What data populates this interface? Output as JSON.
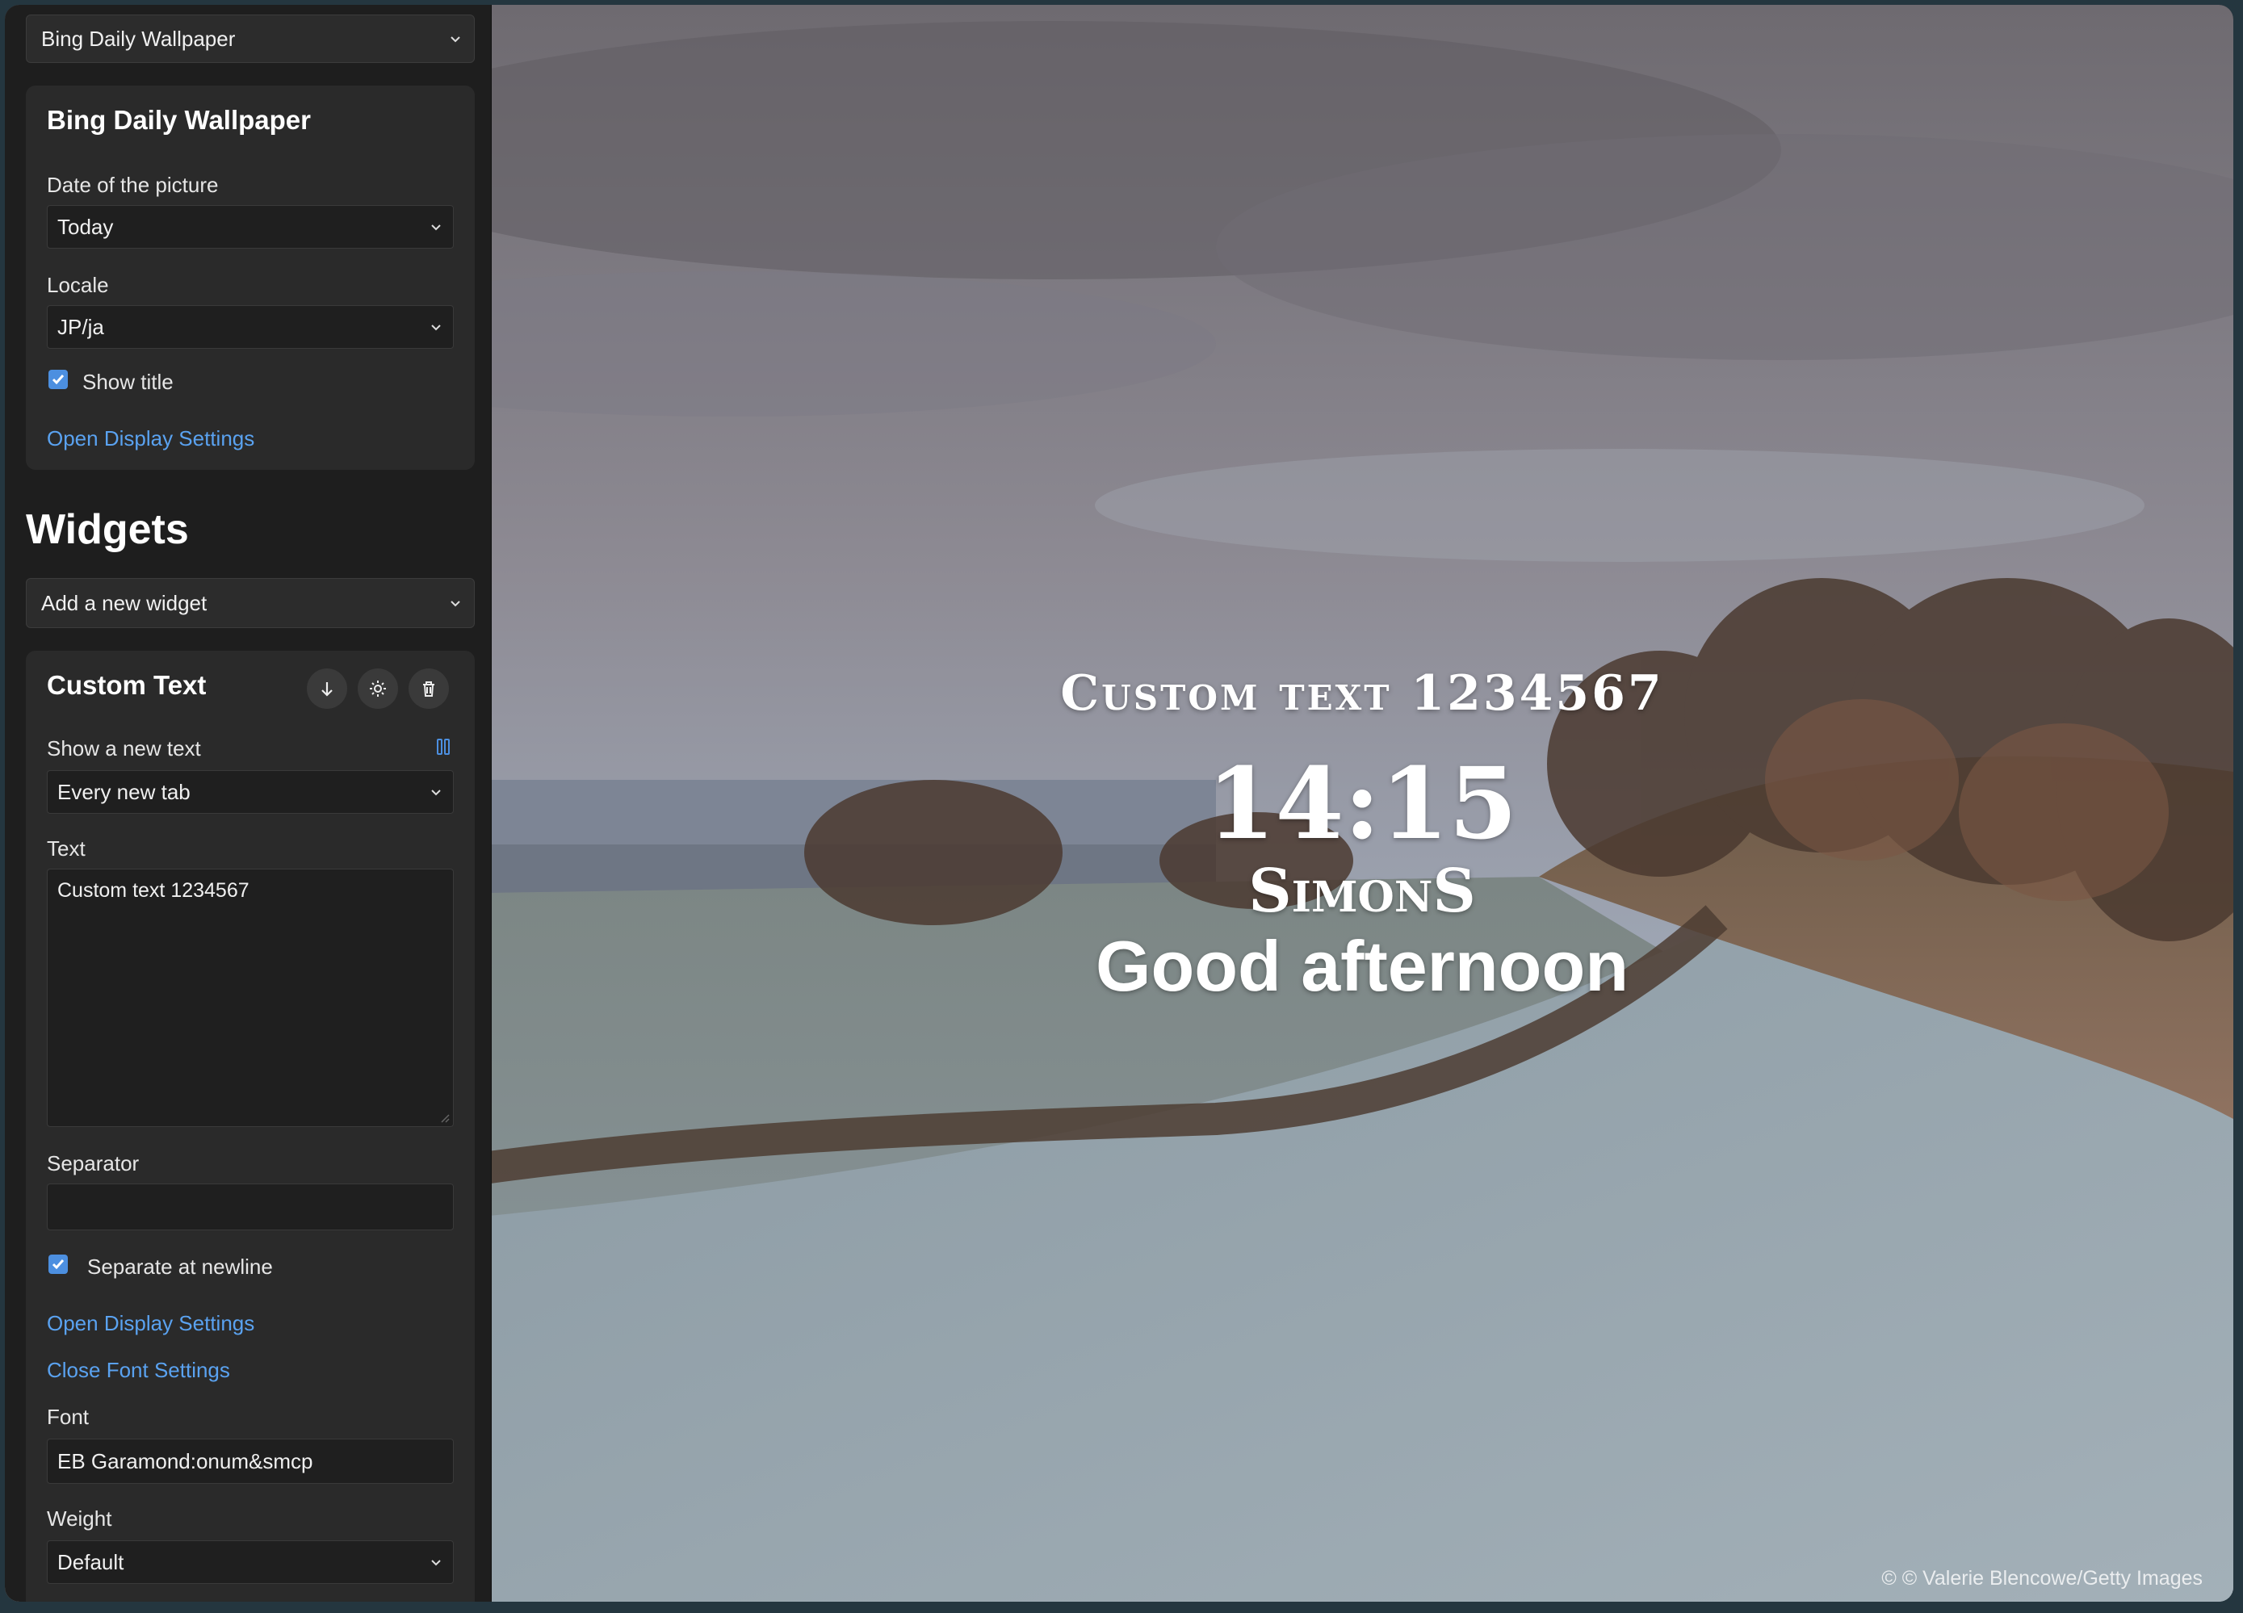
{
  "top_select": {
    "value": "Bing Daily Wallpaper"
  },
  "bing_card": {
    "title": "Bing Daily Wallpaper",
    "date_label": "Date of the picture",
    "date_value": "Today",
    "locale_label": "Locale",
    "locale_value": "JP/ja",
    "show_title_label": "Show title",
    "show_title_checked": true,
    "display_settings_link": "Open Display Settings"
  },
  "widgets": {
    "heading": "Widgets",
    "add_widget_select": "Add a new widget"
  },
  "custom_text_card": {
    "title": "Custom Text",
    "buttons": [
      {
        "icon": "arrow-down-icon",
        "name": "move-down-button"
      },
      {
        "icon": "gear-icon",
        "name": "settings-button"
      },
      {
        "icon": "trash-icon",
        "name": "delete-button"
      }
    ],
    "show_new_label": "Show a new text",
    "show_new_value": "Every new tab",
    "text_label": "Text",
    "text_value": "Custom text 1234567",
    "separator_label": "Separator",
    "separator_value": "",
    "separate_newline_label": "Separate at newline",
    "separate_newline_checked": true,
    "display_settings_link": "Open Display Settings",
    "font_settings_link": "Close Font Settings",
    "font_label": "Font",
    "font_value": "EB Garamond:onum&smcp",
    "weight_label": "Weight",
    "weight_value": "Default"
  },
  "overlay": {
    "custom_text": "Custom text 1234567",
    "time": "14:15",
    "name": "SimonS",
    "greeting": "Good afternoon"
  },
  "credit": "© © Valerie Blencowe/Getty Images",
  "colors": {
    "accent": "#5aa2f0",
    "checkbox": "#4c8fe0",
    "panel_bg": "#1e1e1e",
    "card_bg": "#2a2a2a"
  }
}
